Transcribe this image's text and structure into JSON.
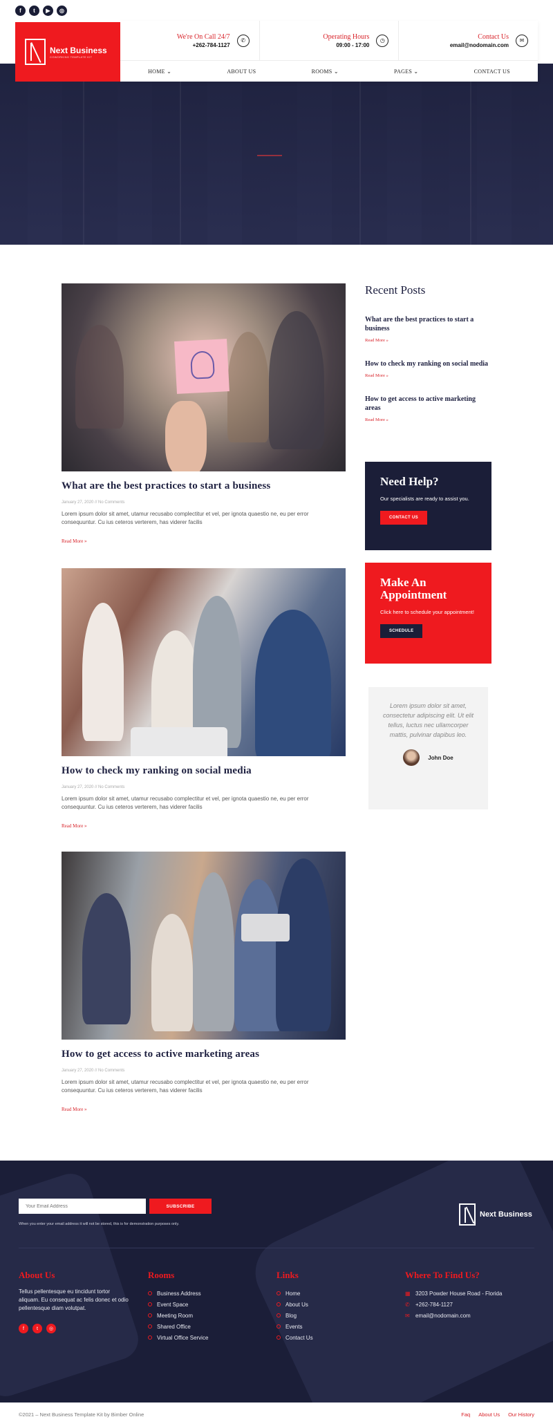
{
  "social_top": [
    {
      "icon": "facebook-icon",
      "glyph": "f"
    },
    {
      "icon": "twitter-icon",
      "glyph": "t"
    },
    {
      "icon": "youtube-icon",
      "glyph": "▶"
    },
    {
      "icon": "instagram-icon",
      "glyph": "◎"
    }
  ],
  "brand": {
    "name": "Next Business",
    "tagline": "COWORKING TEMPLATE KIT"
  },
  "header_info": [
    {
      "label": "We're On Call 24/7",
      "value": "+262-784-1127",
      "icon": "phone-icon",
      "glyph": "✆"
    },
    {
      "label": "Operating Hours",
      "value": "09:00 - 17:00",
      "icon": "clock-icon",
      "glyph": "◷"
    },
    {
      "label": "Contact Us",
      "value": "email@nodomain.com",
      "icon": "envelope-icon",
      "glyph": "✉"
    }
  ],
  "nav": [
    {
      "label": "HOME ⌄"
    },
    {
      "label": "ABOUT US"
    },
    {
      "label": "ROOMS ⌄"
    },
    {
      "label": "PAGES ⌄"
    },
    {
      "label": "CONTACT US"
    }
  ],
  "posts": [
    {
      "title": "What are the best practices to start a business",
      "meta": "January 27, 2020 // No Comments",
      "excerpt": "Lorem ipsum dolor sit amet, utamur recusabo complectitur et vel, per ignota quaestio ne, eu per error consequuntur. Cu ius ceteros verterem, has viderer facilis",
      "read_more": "Read More »"
    },
    {
      "title": "How to check my ranking on social media",
      "meta": "January 27, 2020 // No Comments",
      "excerpt": "Lorem ipsum dolor sit amet, utamur recusabo complectitur et vel, per ignota quaestio ne, eu per error consequuntur. Cu ius ceteros verterem, has viderer facilis",
      "read_more": "Read More »"
    },
    {
      "title": "How to get access to active marketing areas",
      "meta": "January 27, 2020 // No Comments",
      "excerpt": "Lorem ipsum dolor sit amet, utamur recusabo complectitur et vel, per ignota quaestio ne, eu per error consequuntur. Cu ius ceteros verterem, has viderer facilis",
      "read_more": "Read More »"
    }
  ],
  "sidebar": {
    "recent_title": "Recent Posts",
    "recent": [
      {
        "title": "What are the best practices to start a business",
        "read_more": "Read More »"
      },
      {
        "title": "How to check my ranking on social media",
        "read_more": "Read More »"
      },
      {
        "title": "How to get access to active marketing areas",
        "read_more": "Read More »"
      }
    ],
    "help": {
      "title": "Need Help?",
      "text": "Our specialists are ready to assist you.",
      "button": "CONTACT US"
    },
    "appointment": {
      "title": "Make An Appointment",
      "text": "Click here to schedule your appointment!",
      "button": "SCHEDULE"
    },
    "testimonial": {
      "quote": "Lorem ipsum dolor sit amet, consectetur adipiscing elit. Ut elit tellus, luctus nec ullamcorper mattis, pulvinar dapibus leo.",
      "name": "John Doe"
    }
  },
  "footer": {
    "email_placeholder": "Your Email Address",
    "subscribe": "SUBSCRIBE",
    "note": "When you enter your email address it will not be stored, this is for demonstration purposes only.",
    "about": {
      "title": "About Us",
      "text": "Tellus pellentesque eu tincidunt tortor aliquam. Eu consequat ac felis donec et odio pellentesque diam volutpat."
    },
    "social": [
      {
        "icon": "facebook-icon",
        "glyph": "f"
      },
      {
        "icon": "twitter-icon",
        "glyph": "t"
      },
      {
        "icon": "instagram-icon",
        "glyph": "◎"
      }
    ],
    "rooms": {
      "title": "Rooms",
      "items": [
        "Business Address",
        "Event Space",
        "Meeting Room",
        "Shared Office",
        "Virtual Office Service"
      ]
    },
    "links": {
      "title": "Links",
      "items": [
        "Home",
        "About Us",
        "Blog",
        "Events",
        "Contact Us"
      ]
    },
    "find": {
      "title": "Where To Find Us?",
      "items": [
        {
          "icon": "building-icon",
          "glyph": "▦",
          "text": "3203 Powder House Road - Florida"
        },
        {
          "icon": "phone-icon",
          "glyph": "✆",
          "text": "+262-784-1127"
        },
        {
          "icon": "envelope-icon",
          "glyph": "✉",
          "text": "email@nodomain.com"
        }
      ]
    },
    "copyright": "©2021 – Next Business Template Kit by Bimber Online",
    "bottom_links": [
      "Faq",
      "About Us",
      "Our History"
    ]
  },
  "colors": {
    "accent": "#ef1a1f",
    "navy": "#1b1e38"
  }
}
